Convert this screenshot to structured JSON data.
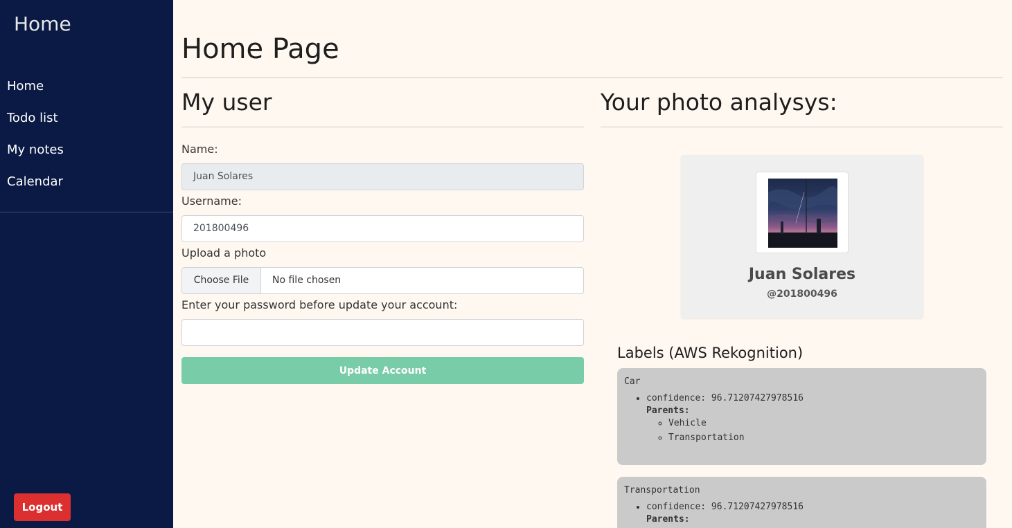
{
  "sidebar": {
    "brand": "Home",
    "items": [
      {
        "label": "Home"
      },
      {
        "label": "Todo list"
      },
      {
        "label": "My notes"
      },
      {
        "label": "Calendar"
      }
    ],
    "logout_label": "Logout"
  },
  "main": {
    "page_title": "Home Page",
    "user_section": {
      "title": "My user",
      "name_label": "Name:",
      "name_value": "Juan Solares",
      "username_label": "Username:",
      "username_value": "201800496",
      "upload_label": "Upload a photo",
      "file_button": "Choose File",
      "file_status": "No file chosen",
      "password_label": "Enter your password before update your account:",
      "password_value": "",
      "update_button": "Update Account"
    },
    "analysis_section": {
      "title": "Your photo analysys:",
      "profile_name": "Juan Solares",
      "profile_handle": "@201800496",
      "labels_title": "Labels (AWS Rekognition)",
      "labels": [
        {
          "name": "Car",
          "confidence": "confidence: 96.71207427978516",
          "parents_label": "Parents:",
          "parents": [
            "Vehicle",
            "Transportation"
          ]
        },
        {
          "name": "Transportation",
          "confidence": "confidence: 96.71207427978516",
          "parents_label": "Parents:",
          "parents": []
        }
      ]
    }
  },
  "colors": {
    "sidebar_bg": "#0a1a44",
    "page_bg": "#fff8f0",
    "logout_bg": "#dc3030",
    "update_bg": "#79cca8",
    "label_card_bg": "#cacaca"
  }
}
